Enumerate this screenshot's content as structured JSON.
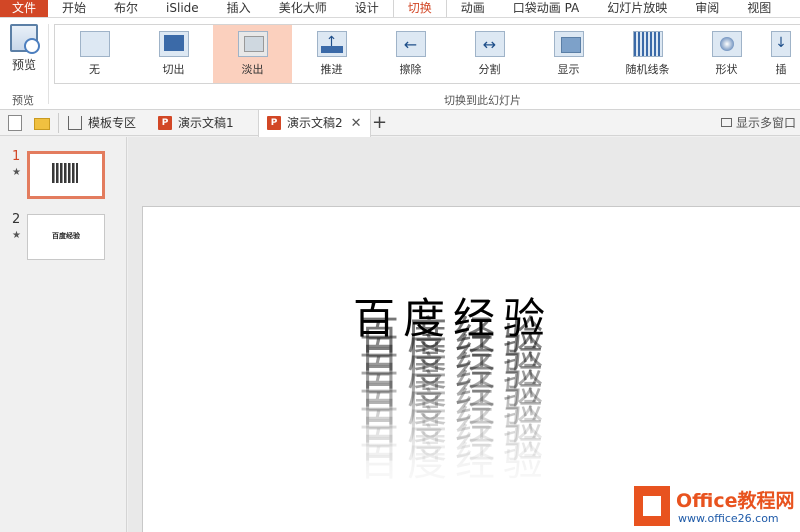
{
  "menu": {
    "items": [
      "文件",
      "开始",
      "布尔",
      "iSlide",
      "插入",
      "美化大师",
      "设计",
      "切换",
      "动画",
      "口袋动画 PA",
      "幻灯片放映",
      "审阅",
      "视图",
      "("
    ],
    "active_index": 7
  },
  "ribbon": {
    "preview_label": "预览",
    "preview_group_label": "预览",
    "transitions_group_label": "切换到此幻灯片",
    "transitions": [
      {
        "label": "无",
        "icon": "none-transition-icon"
      },
      {
        "label": "切出",
        "icon": "cut-transition-icon"
      },
      {
        "label": "淡出",
        "icon": "fade-transition-icon",
        "selected": true
      },
      {
        "label": "推进",
        "icon": "push-transition-icon"
      },
      {
        "label": "擦除",
        "icon": "wipe-transition-icon"
      },
      {
        "label": "分割",
        "icon": "split-transition-icon"
      },
      {
        "label": "显示",
        "icon": "reveal-transition-icon"
      },
      {
        "label": "随机线条",
        "icon": "random-bars-transition-icon"
      },
      {
        "label": "形状",
        "icon": "shape-transition-icon"
      },
      {
        "label": "插",
        "icon": "cover-transition-icon"
      }
    ]
  },
  "tabs": {
    "items": [
      {
        "label": "模板专区",
        "icon": "home-icon"
      },
      {
        "label": "演示文稿1",
        "icon": "ppt-file-icon"
      },
      {
        "label": "演示文稿2",
        "icon": "ppt-file-icon",
        "active": true
      }
    ],
    "ppt_icon_letter": "P",
    "close_glyph": "✕",
    "add_glyph": "+",
    "multi_window_label": "显示多窗口"
  },
  "slides": [
    {
      "number": "1",
      "star": "★",
      "selected": true
    },
    {
      "number": "2",
      "star": "★",
      "thumb_text": "百度经验"
    }
  ],
  "slide": {
    "text": "百度经验"
  },
  "watermark": {
    "title": "Office教程网",
    "url": "www.office26.com"
  },
  "colors": {
    "accent": "#d24726",
    "selected_transition": "#fbd0be",
    "selected_thumb_border": "#e37c5e"
  }
}
